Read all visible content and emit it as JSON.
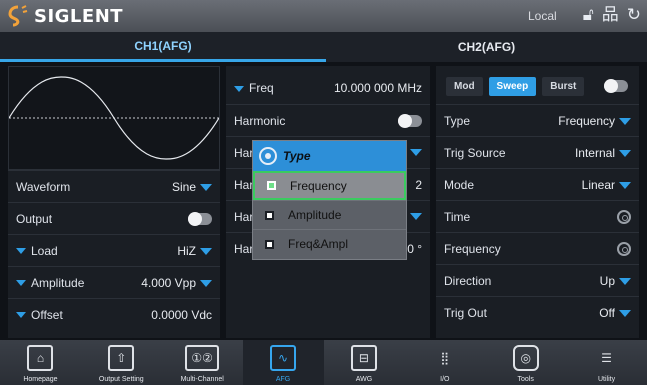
{
  "topbar": {
    "brand": "SIGLENT",
    "status": "Local",
    "icons": [
      "lock-icon",
      "network-icon",
      "refresh-icon"
    ]
  },
  "tabs": [
    {
      "label": "CH1(AFG)",
      "active": true
    },
    {
      "label": "CH2(AFG)",
      "active": false
    }
  ],
  "ch1": {
    "waveform_label": "Waveform",
    "waveform_value": "Sine",
    "output_label": "Output",
    "load_label": "Load",
    "load_value": "HiZ",
    "amplitude_label": "Amplitude",
    "amplitude_value": "4.000 Vpp",
    "offset_label": "Offset",
    "offset_value": "0.0000 Vdc"
  },
  "middle": {
    "freq_label": "Freq",
    "freq_value": "10.000 000 MHz",
    "harmonic_label": "Harmonic",
    "har_rows": [
      {
        "label": "Har",
        "value": ""
      },
      {
        "label": "Har",
        "value": "2"
      },
      {
        "label": "Har",
        "value": ""
      },
      {
        "label": "Har",
        "value": "0 °"
      }
    ]
  },
  "popup": {
    "title": "Type",
    "options": [
      {
        "label": "Frequency",
        "selected": true
      },
      {
        "label": "Amplitude",
        "selected": false
      },
      {
        "label": "Freq&Ampl",
        "selected": false
      }
    ]
  },
  "right": {
    "modes": [
      {
        "label": "Mod",
        "active": false
      },
      {
        "label": "Sweep",
        "active": true
      },
      {
        "label": "Burst",
        "active": false
      }
    ],
    "type_label": "Type",
    "type_value": "Frequency",
    "trig_source_label": "Trig Source",
    "trig_source_value": "Internal",
    "mode_label": "Mode",
    "mode_value": "Linear",
    "time_label": "Time",
    "frequency_label": "Frequency",
    "direction_label": "Direction",
    "direction_value": "Up",
    "trig_out_label": "Trig Out",
    "trig_out_value": "Off"
  },
  "bottom_nav": [
    {
      "label": "Homepage",
      "icon": "home-icon",
      "glyph": "⌂"
    },
    {
      "label": "Output Setting",
      "icon": "output-setting-icon",
      "glyph": "⇧"
    },
    {
      "label": "Multi-Channel",
      "icon": "multi-channel-icon",
      "glyph": "①②"
    },
    {
      "label": "AFG",
      "icon": "afg-icon",
      "glyph": "∿"
    },
    {
      "label": "AWG",
      "icon": "awg-icon",
      "glyph": "⊟"
    },
    {
      "label": "I/O",
      "icon": "io-icon",
      "glyph": "⣿"
    },
    {
      "label": "Tools",
      "icon": "tools-icon",
      "glyph": "◎"
    },
    {
      "label": "Utility",
      "icon": "utility-icon",
      "glyph": "☰"
    }
  ],
  "colors": {
    "accent": "#2e9ee6",
    "selected_option_border": "#3acb5f"
  }
}
